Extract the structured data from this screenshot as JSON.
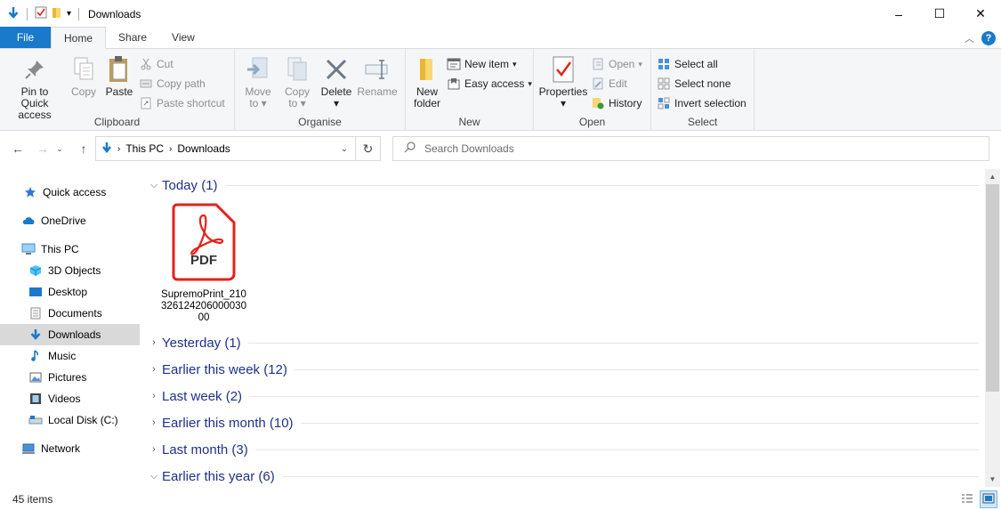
{
  "window": {
    "title": "Downloads",
    "controls": {
      "minimize": "–",
      "maximize": "☐",
      "close": "✕"
    }
  },
  "ribbon_tabs": [
    "File",
    "Home",
    "Share",
    "View"
  ],
  "ribbon": {
    "clipboard": {
      "label": "Clipboard",
      "pin": "Pin to Quick access",
      "pin_line1": "Pin to Quick",
      "pin_line2": "access",
      "copy": "Copy",
      "paste": "Paste",
      "cut": "Cut",
      "copy_path": "Copy path",
      "paste_shortcut": "Paste shortcut"
    },
    "organise": {
      "label": "Organise",
      "move_to": "Move",
      "move_to_2": "to",
      "copy_to": "Copy",
      "copy_to_2": "to",
      "delete": "Delete",
      "rename": "Rename"
    },
    "new": {
      "label": "New",
      "new_folder_1": "New",
      "new_folder_2": "folder",
      "new_item": "New item",
      "easy_access": "Easy access"
    },
    "open": {
      "label": "Open",
      "properties": "Properties",
      "open": "Open",
      "edit": "Edit",
      "history": "History"
    },
    "select": {
      "label": "Select",
      "select_all": "Select all",
      "select_none": "Select none",
      "invert_selection": "Invert selection"
    }
  },
  "address": {
    "crumbs": [
      "This PC",
      "Downloads"
    ],
    "search_placeholder": "Search Downloads"
  },
  "nav_pane": {
    "quick_access": "Quick access",
    "onedrive": "OneDrive",
    "this_pc": "This PC",
    "objects_3d": "3D Objects",
    "desktop": "Desktop",
    "documents": "Documents",
    "downloads": "Downloads",
    "music": "Music",
    "pictures": "Pictures",
    "videos": "Videos",
    "local_disk": "Local Disk (C:)",
    "network": "Network"
  },
  "groups": {
    "today": "Today (1)",
    "yesterday": "Yesterday (1)",
    "earlier_week": "Earlier this week (12)",
    "last_week": "Last week (2)",
    "earlier_month": "Earlier this month (10)",
    "last_month": "Last month (3)",
    "earlier_year": "Earlier this year (6)"
  },
  "file": {
    "icon_text": "PDF",
    "name": "SupremoPrint_21032612420600003000"
  },
  "status": {
    "item_count": "45 items"
  },
  "colors": {
    "accent": "#1979ca",
    "group_header": "#1e3287",
    "pdf_red": "#e2231a",
    "selection": "#d9d9d9"
  }
}
